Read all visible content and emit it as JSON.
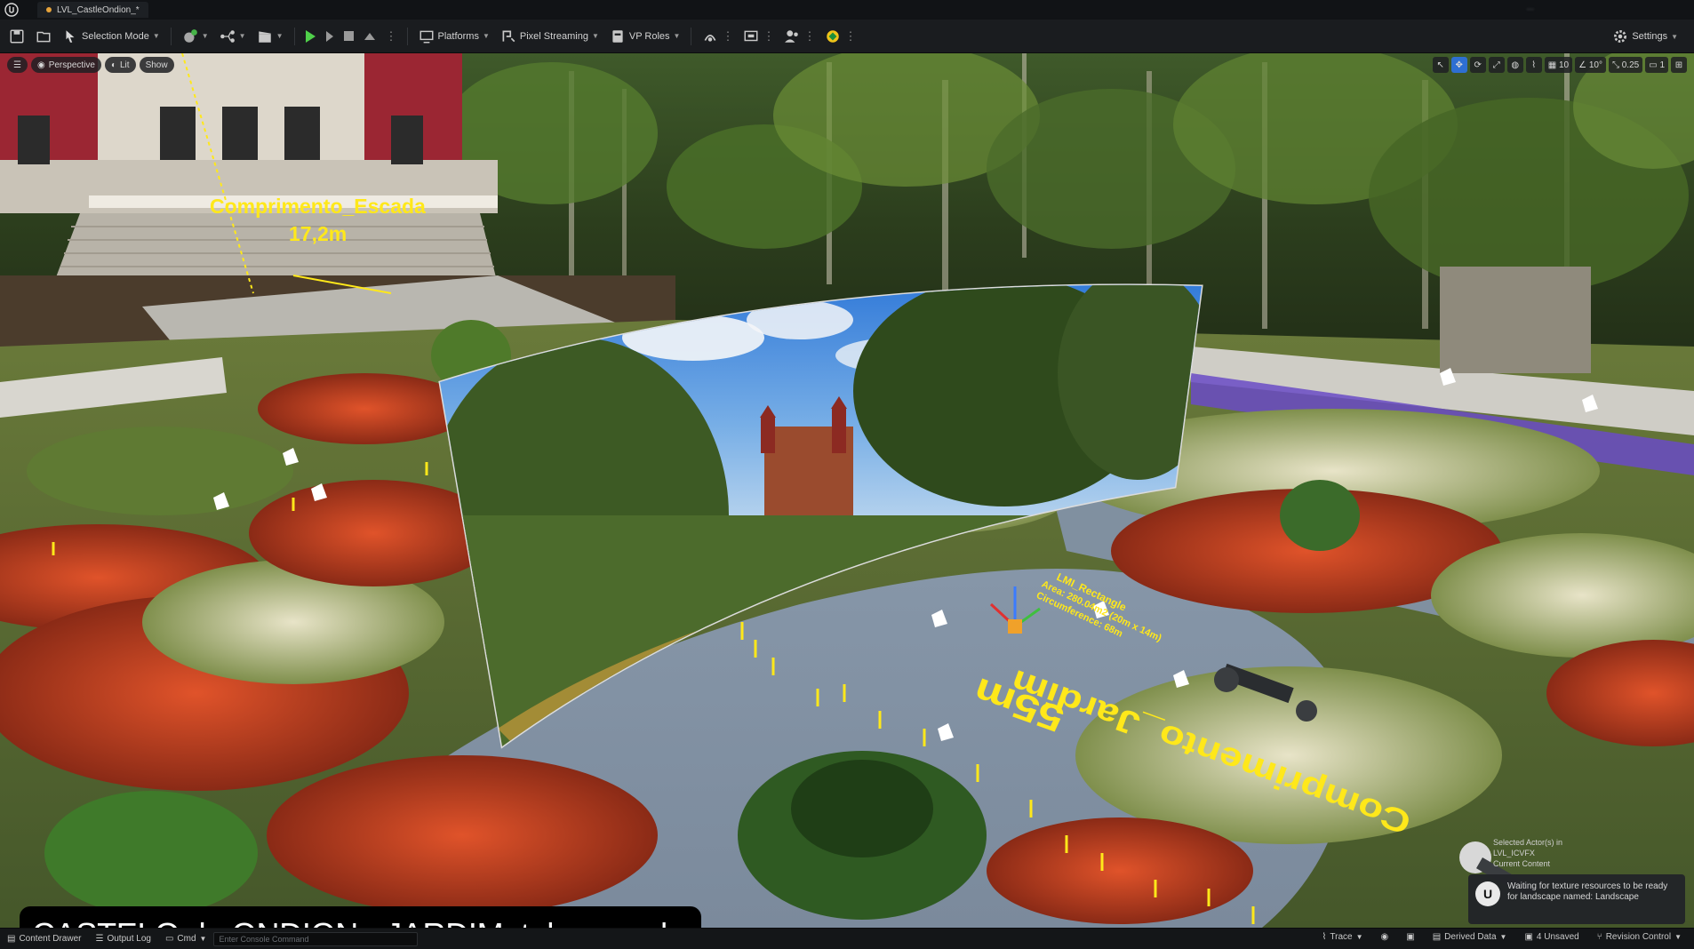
{
  "titlebar": {
    "level_tab": "LVL_CastleOndion_*",
    "right_text": "..."
  },
  "toolbar": {
    "selection_mode": "Selection Mode",
    "platforms": "Platforms",
    "pixel_streaming": "Pixel Streaming",
    "vp_roles": "VP Roles",
    "settings": "Settings"
  },
  "viewport": {
    "perspective": "Perspective",
    "lit": "Lit",
    "show": "Show",
    "grid_snap": "10",
    "rot_snap": "10°",
    "scale_snap": "0.25",
    "camera_speed": "1"
  },
  "scene": {
    "stair_label_name": "Comprimento_Escada",
    "stair_label_value": "17,2m",
    "garden_label_name": "Comprimento_Jardim",
    "garden_label_value": "55m",
    "lmi_title": "LMI_Rectangle",
    "lmi_area": "Area: 280.04m2 (20m x 14m)",
    "lmi_circ": "Circumference: 68m"
  },
  "selection_info": {
    "line1": "Selected Actor(s) in",
    "line2": "LVL_ICVFX",
    "line3": "Current Content"
  },
  "toast": {
    "message": "Waiting for texture resources to be ready for landscape named: Landscape"
  },
  "caption": {
    "text": "CASTELO de ONDION - JARDIM_tela unreal"
  },
  "statusbar": {
    "content_drawer": "Content Drawer",
    "output_log": "Output Log",
    "cmd": "Cmd",
    "console_placeholder": "Enter Console Command",
    "trace": "Trace",
    "derived_data": "Derived Data",
    "unsaved": "4 Unsaved",
    "revision_control": "Revision Control"
  },
  "colors": {
    "label_yellow": "#ffe81a",
    "play_green": "#4fd04a",
    "accent_blue": "#2e6fd2"
  }
}
